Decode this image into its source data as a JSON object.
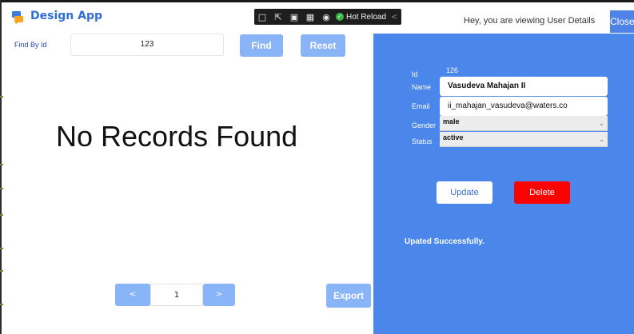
{
  "app": {
    "title": "Design App",
    "accent": "#2f6fd6"
  },
  "devbar": {
    "hot_reload_label": "Hot Reload",
    "collapse_glyph": "<",
    "tools": [
      "select-icon",
      "pointer-icon",
      "frame-icon",
      "layout-icon",
      "adorner-icon"
    ]
  },
  "search": {
    "label": "Find By Id",
    "value": "123",
    "find_label": "Find",
    "reset_label": "Reset"
  },
  "results": {
    "empty_message": "No Records Found"
  },
  "pagination": {
    "prev_label": "<",
    "page": "1",
    "next_label": ">",
    "export_label": "Export"
  },
  "header": {
    "greeting": "Hey, you are viewing User Details",
    "close_label": "Close"
  },
  "details": {
    "id_label": "Id",
    "id_value": "126",
    "name_label": "Name",
    "name_value": "Vasudeva Mahajan II",
    "email_label": "Email",
    "email_value": "ii_mahajan_vasudeva@waters.co",
    "gender_label": "Gender",
    "gender_value": "male",
    "status_label": "Status",
    "status_value": "active",
    "update_label": "Update",
    "delete_label": "Delete",
    "message": "Upated Successfully.",
    "panel_color": "#4b86ea",
    "delete_color": "#ff0000"
  }
}
